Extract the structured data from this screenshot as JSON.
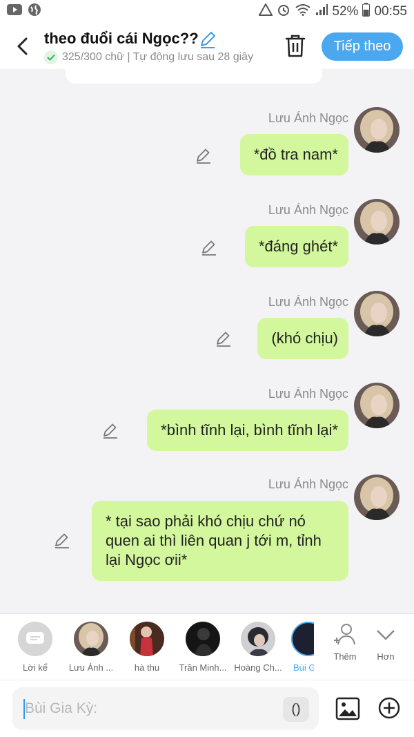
{
  "status_bar": {
    "battery": "52%",
    "time": "00:55"
  },
  "header": {
    "title": "theo đuổi cái Ngọc??",
    "subtitle": "325/300 chữ | Tự động lưu sau 28 giây",
    "next_button": "Tiếp theo"
  },
  "messages": [
    {
      "sender": "Lưu Ánh Ngọc",
      "lines": [
        "*đồ tra nam*"
      ]
    },
    {
      "sender": "Lưu Ánh Ngọc",
      "lines": [
        "*đáng ghét*"
      ]
    },
    {
      "sender": "Lưu Ánh Ngọc",
      "lines": [
        "(khó chịu)"
      ]
    },
    {
      "sender": "Lưu Ánh Ngọc",
      "lines": [
        "*bình tĩnh lại, bình tĩnh lại*"
      ]
    },
    {
      "sender": "Lưu Ánh Ngọc",
      "lines": [
        "* tại sao phải khó chịu chứ nó",
        "quen ai thì liên quan j tới m, tỉnh",
        "lại Ngọc ơii*"
      ]
    }
  ],
  "characters": [
    {
      "label": "Lời kể"
    },
    {
      "label": "Lưu Ánh ..."
    },
    {
      "label": "hà thu"
    },
    {
      "label": "Trần Minh..."
    },
    {
      "label": "Hoàng Ch..."
    },
    {
      "label": "Bùi G"
    }
  ],
  "actions": {
    "add_label": "Thêm",
    "more_label": "Hơn"
  },
  "composer": {
    "placeholder": "Bùi Gia Kỳ:",
    "paren_button": "()"
  },
  "colors": {
    "accent": "#4ba8ee",
    "bubble": "#d3f79c",
    "background": "#f3f3f5"
  }
}
